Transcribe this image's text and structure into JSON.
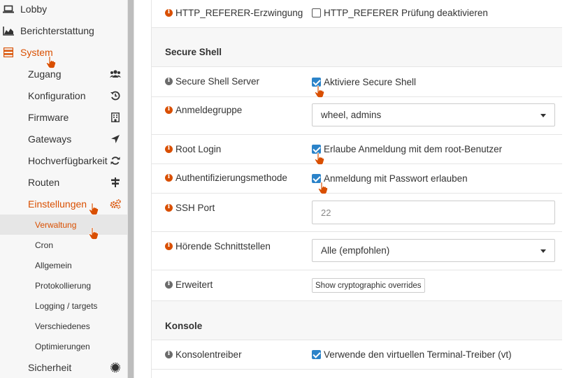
{
  "sidebar": {
    "top_items": [
      {
        "label": "Lobby",
        "icon": "laptop-icon"
      },
      {
        "label": "Berichterstattung",
        "icon": "area-chart-icon"
      },
      {
        "label": "System",
        "icon": "server-icon"
      }
    ],
    "system_items": [
      {
        "label": "Zugang",
        "icon": "users-icon"
      },
      {
        "label": "Konfiguration",
        "icon": "history-icon"
      },
      {
        "label": "Firmware",
        "icon": "building-icon"
      },
      {
        "label": "Gateways",
        "icon": "location-arrow-icon"
      },
      {
        "label": "Hochverfügbarkeit",
        "icon": "refresh-icon"
      },
      {
        "label": "Routen",
        "icon": "map-signs-icon"
      },
      {
        "label": "Einstellungen",
        "icon": "cogs-icon"
      }
    ],
    "settings_items": [
      {
        "label": "Verwaltung"
      },
      {
        "label": "Cron"
      },
      {
        "label": "Allgemein"
      },
      {
        "label": "Protokollierung"
      },
      {
        "label": "Logging / targets"
      },
      {
        "label": "Verschiedenes"
      },
      {
        "label": "Optimierungen"
      }
    ],
    "bottom_item": {
      "label": "Sicherheit",
      "icon": "certificate-icon"
    }
  },
  "form": {
    "referer": {
      "label": "HTTP_REFERER-Erzwingung",
      "checkbox_label": "HTTP_REFERER Prüfung deaktivieren",
      "checked": false
    },
    "ssh_section_title": "Secure Shell",
    "ssh_server": {
      "label": "Secure Shell Server",
      "checkbox_label": "Aktiviere Secure Shell",
      "checked": true
    },
    "login_group": {
      "label": "Anmeldegruppe",
      "value": "wheel, admins"
    },
    "root_login": {
      "label": "Root Login",
      "checkbox_label": "Erlaube Anmeldung mit dem root-Benutzer",
      "checked": true
    },
    "auth_method": {
      "label": "Authentifizierungsmethode",
      "checkbox_label": "Anmeldung mit Passwort erlauben",
      "checked": true
    },
    "ssh_port": {
      "label": "SSH Port",
      "placeholder": "22"
    },
    "listen_interfaces": {
      "label": "Hörende Schnittstellen",
      "value": "Alle (empfohlen)"
    },
    "advanced": {
      "label": "Erweitert",
      "button_label": "Show cryptographic overrides"
    },
    "console_section_title": "Konsole",
    "console_driver": {
      "label": "Konsolentreiber",
      "checkbox_label": "Verwende den virtuellen Terminal-Treiber (vt)",
      "checked": true
    }
  },
  "colors": {
    "accent": "#d94f00",
    "checkbox": "#2b83c9"
  }
}
